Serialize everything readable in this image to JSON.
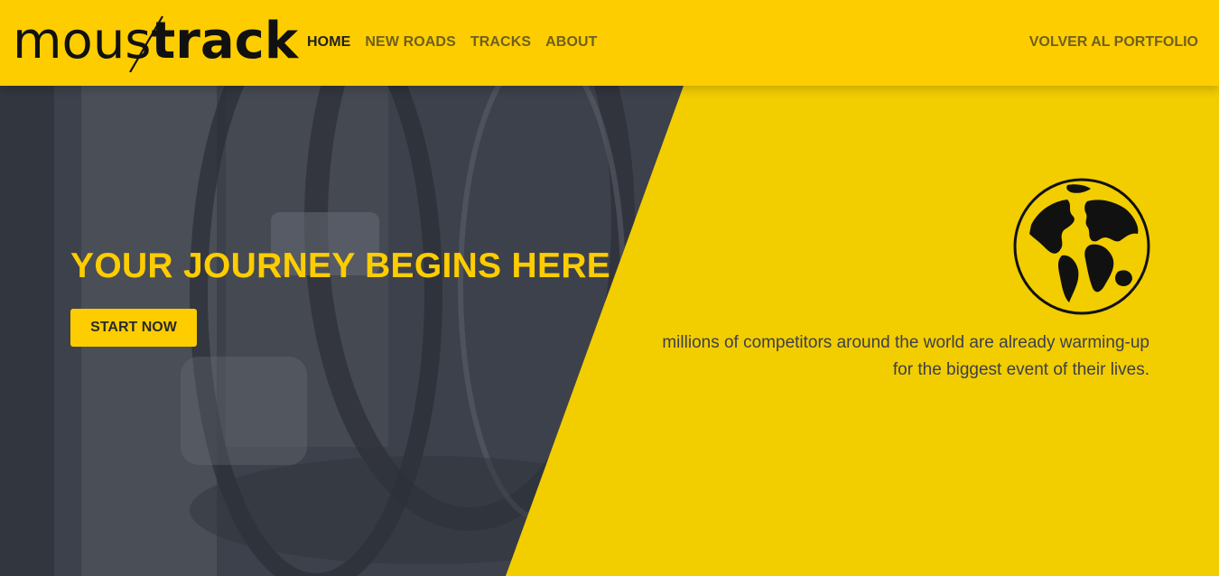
{
  "header": {
    "logo": {
      "part1": "mous",
      "part2": "track",
      "alt": "moustrack"
    },
    "nav": [
      {
        "label": "HOME",
        "active": true
      },
      {
        "label": "NEW ROADS",
        "active": false
      },
      {
        "label": "TRACKS",
        "active": false
      },
      {
        "label": "ABOUT",
        "active": false
      }
    ],
    "back_link": "VOLVER AL PORTFOLIO"
  },
  "hero": {
    "title": "YOUR JOURNEY BEGINS HERE",
    "cta_label": "START NOW",
    "tagline_line1": "millions of competitors around the world are already warming-up",
    "tagline_line2": "for the biggest event of their lives.",
    "globe_icon": "globe-icon",
    "background_image": "bicycle wheels (darkened photo)"
  },
  "colors": {
    "brand_yellow": "#fecd00",
    "hero_yellow": "#f2cd00",
    "dark_slate": "#3d414b",
    "text_dark": "#3d3f4a",
    "nav_inactive": "#6e6020"
  }
}
